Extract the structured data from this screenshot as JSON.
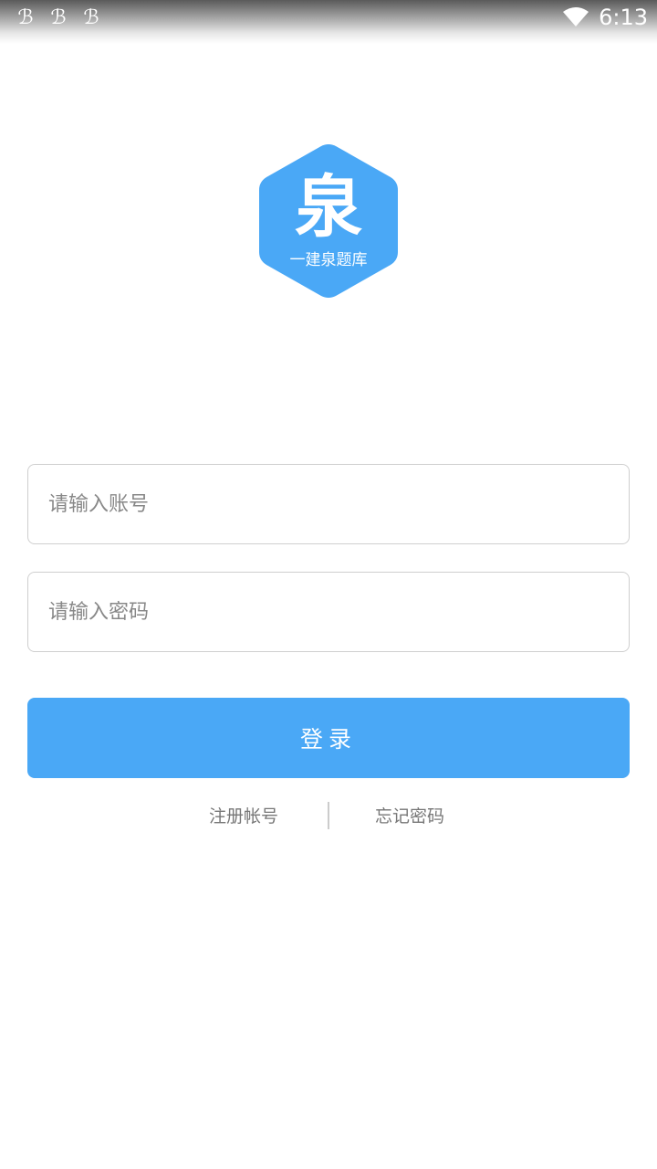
{
  "status_bar": {
    "notification_icons": [
      "notification-icon",
      "notification-icon",
      "notification-icon"
    ],
    "wifi_icon": "wifi-icon",
    "time": "6:13"
  },
  "logo": {
    "icon": "hexagon-logo-icon",
    "main_char": "泉",
    "subtitle": "一建泉题库",
    "color": "#4aa8f6"
  },
  "form": {
    "account_placeholder": "请输入账号",
    "account_value": "",
    "password_placeholder": "请输入密码",
    "password_value": "",
    "login_label": "登录"
  },
  "links": {
    "register_label": "注册帐号",
    "forgot_label": "忘记密码"
  },
  "colors": {
    "accent": "#4aa8f6",
    "border": "#cfcfcf",
    "link": "#777777"
  }
}
